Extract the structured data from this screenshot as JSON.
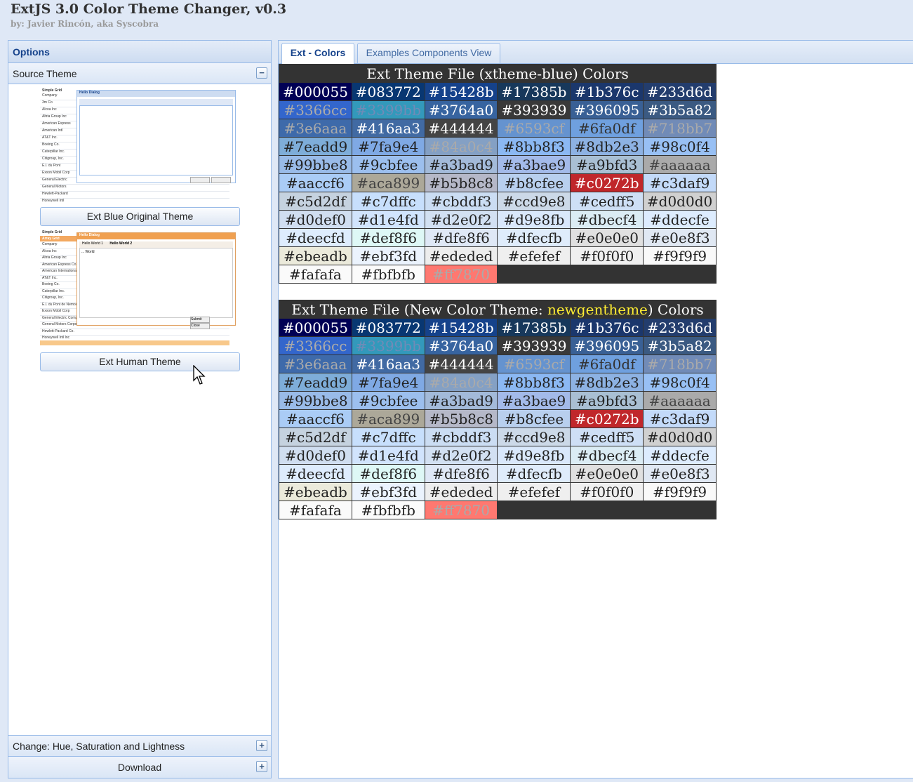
{
  "app": {
    "title": "ExtJS 3.0 Color Theme Changer, v0.3",
    "subtitle": "by: Javier Rincón, aka Syscobra"
  },
  "left_panel": {
    "title": "Options",
    "sections": [
      {
        "label": "Source Theme",
        "state": "expanded",
        "tool": "−"
      },
      {
        "label": "Change: Hue, Saturation and Lightness",
        "state": "collapsed",
        "tool": "+"
      },
      {
        "label": "Download",
        "state": "collapsed",
        "tool": "+"
      }
    ],
    "themes": [
      {
        "label": "Ext Blue Original Theme"
      },
      {
        "label": "Ext Human Theme"
      }
    ],
    "thumb_blue": {
      "grid_title": "Simple Grid",
      "dialog_title": "Hello Dialog",
      "rows": [
        "Company",
        "3m Co",
        "Alcoa Inc",
        "Altria Group Inc",
        "American Express",
        "American Intl",
        "AT&T Inc.",
        "Boeing Co.",
        "Caterpillar Inc.",
        "Citigroup, Inc.",
        "E.I. du Pont",
        "Exxon Mobil Corp",
        "General Electric",
        "General Motors",
        "Hewlett-Packard",
        "Honeywell Intl"
      ]
    },
    "thumb_human": {
      "grid_title": "Simple Grid",
      "header_label": "Array Grid",
      "dialog_title": "Hello Dialog",
      "tab1": "Hello World 1",
      "tab2": "Hello World 2",
      "body_text": "... World",
      "btn_submit": "Submit",
      "btn_close": "Close",
      "rows": [
        "Company",
        "Alcoa Inc",
        "Altria Group Inc",
        "American Express Co",
        "American International",
        "AT&T Inc.",
        "Boeing Co.",
        "Caterpillar Inc.",
        "Citigroup, Inc.",
        "E.I. du Pont de Nemours",
        "Exxon Mobil Corp",
        "General Electric Comp",
        "General Motors Corporation",
        "Hewlett-Packard Co.",
        "Honeywell Intl Inc"
      ]
    }
  },
  "tabs": [
    {
      "label": "Ext - Colors",
      "active": true
    },
    {
      "label": "Examples Components View",
      "active": false
    }
  ],
  "tables": [
    {
      "caption_prefix": "Ext Theme File (xtheme-blue) Colors",
      "caption_highlight": "",
      "caption_suffix": ""
    },
    {
      "caption_prefix": "Ext Theme File (New Color Theme: ",
      "caption_highlight": "newgentheme",
      "caption_suffix": ") Colors"
    }
  ],
  "swatches": [
    {
      "hex": "#000055",
      "text": "#ffffff"
    },
    {
      "hex": "#083772",
      "text": "#ffffff"
    },
    {
      "hex": "#15428b",
      "text": "#ffffff"
    },
    {
      "hex": "#17385b",
      "text": "#ffffff"
    },
    {
      "hex": "#1b376c",
      "text": "#ffffff"
    },
    {
      "hex": "#233d6d",
      "text": "#ffffff"
    },
    {
      "hex": "#3366cc",
      "text": "#aaaaaa"
    },
    {
      "hex": "#3399bb",
      "text": "#718bb7"
    },
    {
      "hex": "#3764a0",
      "text": "#ffffff"
    },
    {
      "hex": "#393939",
      "text": "#ffffff"
    },
    {
      "hex": "#396095",
      "text": "#ffffff"
    },
    {
      "hex": "#3b5a82",
      "text": "#ffffff"
    },
    {
      "hex": "#3e6aaa",
      "text": "#aaaaaa"
    },
    {
      "hex": "#416aa3",
      "text": "#ffffff"
    },
    {
      "hex": "#444444",
      "text": "#ffffff"
    },
    {
      "hex": "#6593cf",
      "text": "#aaaaaa"
    },
    {
      "hex": "#6fa0df",
      "text": "#333333"
    },
    {
      "hex": "#718bb7",
      "text": "#aaaaaa"
    },
    {
      "hex": "#7eadd9",
      "text": "#222222"
    },
    {
      "hex": "#7fa9e4",
      "text": "#222222"
    },
    {
      "hex": "#84a0c4",
      "text": "#aaaaaa"
    },
    {
      "hex": "#8bb8f3",
      "text": "#222222"
    },
    {
      "hex": "#8db2e3",
      "text": "#222222"
    },
    {
      "hex": "#98c0f4",
      "text": "#222222"
    },
    {
      "hex": "#99bbe8",
      "text": "#222222"
    },
    {
      "hex": "#9cbfee",
      "text": "#222222"
    },
    {
      "hex": "#a3bad9",
      "text": "#222222"
    },
    {
      "hex": "#a3bae9",
      "text": "#222222"
    },
    {
      "hex": "#a9bfd3",
      "text": "#222222"
    },
    {
      "hex": "#aaaaaa",
      "text": "#444444"
    },
    {
      "hex": "#aaccf6",
      "text": "#222222"
    },
    {
      "hex": "#aca899",
      "text": "#444444"
    },
    {
      "hex": "#b5b8c8",
      "text": "#222222"
    },
    {
      "hex": "#b8cfee",
      "text": "#222222"
    },
    {
      "hex": "#c0272b",
      "text": "#ffffff"
    },
    {
      "hex": "#c3daf9",
      "text": "#222222"
    },
    {
      "hex": "#c5d2df",
      "text": "#222222"
    },
    {
      "hex": "#c7dffc",
      "text": "#222222"
    },
    {
      "hex": "#cbddf3",
      "text": "#222222"
    },
    {
      "hex": "#ccd9e8",
      "text": "#222222"
    },
    {
      "hex": "#cedff5",
      "text": "#222222"
    },
    {
      "hex": "#d0d0d0",
      "text": "#222222"
    },
    {
      "hex": "#d0def0",
      "text": "#222222"
    },
    {
      "hex": "#d1e4fd",
      "text": "#222222"
    },
    {
      "hex": "#d2e0f2",
      "text": "#222222"
    },
    {
      "hex": "#d9e8fb",
      "text": "#222222"
    },
    {
      "hex": "#dbecf4",
      "text": "#222222"
    },
    {
      "hex": "#ddecfe",
      "text": "#222222"
    },
    {
      "hex": "#deecfd",
      "text": "#222222"
    },
    {
      "hex": "#def8f6",
      "text": "#222222"
    },
    {
      "hex": "#dfe8f6",
      "text": "#222222"
    },
    {
      "hex": "#dfecfb",
      "text": "#222222"
    },
    {
      "hex": "#e0e0e0",
      "text": "#222222"
    },
    {
      "hex": "#e0e8f3",
      "text": "#222222"
    },
    {
      "hex": "#ebeadb",
      "text": "#222222"
    },
    {
      "hex": "#ebf3fd",
      "text": "#222222"
    },
    {
      "hex": "#ededed",
      "text": "#222222"
    },
    {
      "hex": "#efefef",
      "text": "#222222"
    },
    {
      "hex": "#f0f0f0",
      "text": "#222222"
    },
    {
      "hex": "#f9f9f9",
      "text": "#222222"
    },
    {
      "hex": "#fafafa",
      "text": "#222222"
    },
    {
      "hex": "#fbfbfb",
      "text": "#222222"
    },
    {
      "hex": "#ff7870",
      "text": "#aaaaaa"
    }
  ]
}
